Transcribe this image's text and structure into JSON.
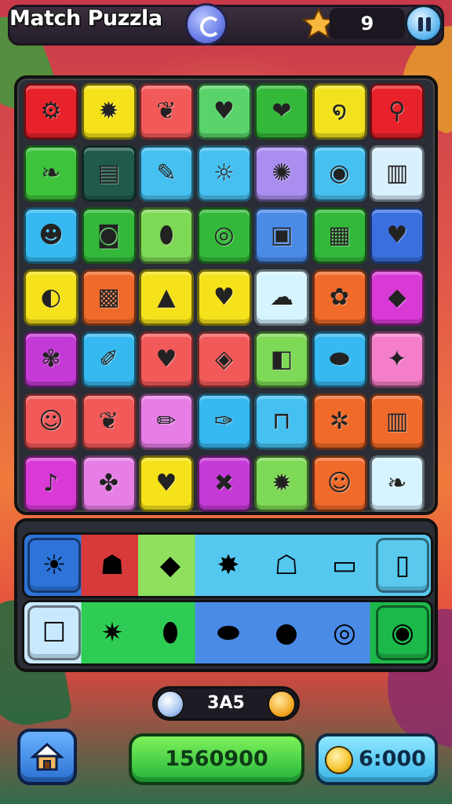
{
  "header": {
    "title": "Match Puzzla",
    "star_count": "9"
  },
  "board": {
    "rows": [
      [
        {
          "color": "#e8222a",
          "icon": "gear-icon",
          "glyph": "⚙"
        },
        {
          "color": "#f5e21a",
          "icon": "flower-icon",
          "glyph": "✹"
        },
        {
          "color": "#f25a5a",
          "icon": "leaf-icon",
          "glyph": "❦"
        },
        {
          "color": "#5ad46a",
          "icon": "heart-icon",
          "glyph": "♥"
        },
        {
          "color": "#34b83a",
          "icon": "strawberry-icon",
          "glyph": "❤"
        },
        {
          "color": "#f2e21e",
          "icon": "swirl-icon",
          "glyph": "໑"
        },
        {
          "color": "#e8222a",
          "icon": "magnifier-icon",
          "glyph": "⚲"
        }
      ],
      [
        {
          "color": "#3ec43c",
          "icon": "leaf-icon",
          "glyph": "❧"
        },
        {
          "color": "#1f5a4a",
          "icon": "document-icon",
          "glyph": "▤"
        },
        {
          "color": "#46c0f0",
          "icon": "pin-icon",
          "glyph": "✎"
        },
        {
          "color": "#46c0f0",
          "icon": "sun-face-icon",
          "glyph": "☼"
        },
        {
          "color": "#a98ef0",
          "icon": "sun-icon",
          "glyph": "✺"
        },
        {
          "color": "#46c0f0",
          "icon": "ring-icon",
          "glyph": "◉"
        },
        {
          "color": "#d9f0ff",
          "icon": "jar-icon",
          "glyph": "▥"
        }
      ],
      [
        {
          "color": "#36b9f0",
          "icon": "cat-face-icon",
          "glyph": "☻"
        },
        {
          "color": "#34b83a",
          "icon": "camera-icon",
          "glyph": "◙"
        },
        {
          "color": "#7ed956",
          "icon": "feather-icon",
          "glyph": "⬮"
        },
        {
          "color": "#34b83a",
          "icon": "donut-icon",
          "glyph": "◎"
        },
        {
          "color": "#4a8be8",
          "icon": "box-face-icon",
          "glyph": "▣"
        },
        {
          "color": "#34b83a",
          "icon": "picture-icon",
          "glyph": "▦"
        },
        {
          "color": "#3a6fe0",
          "icon": "heart-icon",
          "glyph": "♥"
        }
      ],
      [
        {
          "color": "#f5e21a",
          "icon": "ball-icon",
          "glyph": "◐"
        },
        {
          "color": "#f06a2a",
          "icon": "cookie-icon",
          "glyph": "▩"
        },
        {
          "color": "#f5e21a",
          "icon": "cone-icon",
          "glyph": "▲"
        },
        {
          "color": "#f5e21a",
          "icon": "heart-face-icon",
          "glyph": "♥"
        },
        {
          "color": "#d6f4ff",
          "icon": "blob-icon",
          "glyph": "☁"
        },
        {
          "color": "#f06a2a",
          "icon": "flower-icon",
          "glyph": "✿"
        },
        {
          "color": "#d93ad6",
          "icon": "crystal-icon",
          "glyph": "◆"
        }
      ],
      [
        {
          "color": "#c43ad6",
          "icon": "flower-icon",
          "glyph": "✾"
        },
        {
          "color": "#36b9f0",
          "icon": "pencil-icon",
          "glyph": "✐"
        },
        {
          "color": "#f25a5a",
          "icon": "heart-face-icon",
          "glyph": "♥"
        },
        {
          "color": "#f25a5a",
          "icon": "badge-icon",
          "glyph": "◈"
        },
        {
          "color": "#7ed956",
          "icon": "cube-icon",
          "glyph": "◧"
        },
        {
          "color": "#36b9f0",
          "icon": "eggplant-icon",
          "glyph": "⬬"
        },
        {
          "color": "#f47ec9",
          "icon": "chat-bubble-icon",
          "glyph": "✦"
        }
      ],
      [
        {
          "color": "#f25a5a",
          "icon": "smiley-icon",
          "glyph": "☺"
        },
        {
          "color": "#f25a5a",
          "icon": "leaf-icon",
          "glyph": "❦"
        },
        {
          "color": "#e77ee6",
          "icon": "pencil-icon",
          "glyph": "✏"
        },
        {
          "color": "#36b9f0",
          "icon": "brush-icon",
          "glyph": "✑"
        },
        {
          "color": "#46c0f0",
          "icon": "table-icon",
          "glyph": "⊓"
        },
        {
          "color": "#f06a2a",
          "icon": "gear-icon",
          "glyph": "✲"
        },
        {
          "color": "#f06a2a",
          "icon": "jar-icon",
          "glyph": "▥"
        }
      ],
      [
        {
          "color": "#d93ad6",
          "icon": "bell-icon",
          "glyph": "♪"
        },
        {
          "color": "#e77ee6",
          "icon": "star-blob-icon",
          "glyph": "✤"
        },
        {
          "color": "#f5e21a",
          "icon": "heart-icon",
          "glyph": "♥"
        },
        {
          "color": "#c43ad6",
          "icon": "cross-icon",
          "glyph": "✖"
        },
        {
          "color": "#7ed956",
          "icon": "sun-icon",
          "glyph": "✹"
        },
        {
          "color": "#f06a2a",
          "icon": "smiley-icon",
          "glyph": "☺"
        },
        {
          "color": "#d6f4ff",
          "icon": "leaf-icon",
          "glyph": "❧"
        }
      ]
    ]
  },
  "tray": {
    "row1": [
      {
        "icon": "sun-face-icon",
        "glyph": "☀"
      },
      {
        "icon": "ghost-icon",
        "glyph": "☗"
      },
      {
        "icon": "diamond-icon",
        "glyph": "◆"
      },
      {
        "icon": "spiky-ball-icon",
        "glyph": "✸"
      },
      {
        "icon": "robot-icon",
        "glyph": "☖"
      },
      {
        "icon": "card-icon",
        "glyph": "▭"
      },
      {
        "icon": "bin-icon",
        "glyph": "▯"
      }
    ],
    "row2": [
      {
        "icon": "jar-icon",
        "glyph": "☐"
      },
      {
        "icon": "bug-icon",
        "glyph": "✷"
      },
      {
        "icon": "popsicle-icon",
        "glyph": "⬮"
      },
      {
        "icon": "eggplant-icon",
        "glyph": "⬬"
      },
      {
        "icon": "apple-icon",
        "glyph": "●"
      },
      {
        "icon": "donut-icon",
        "glyph": "◎"
      },
      {
        "icon": "candy-icon",
        "glyph": "◉"
      }
    ]
  },
  "footer": {
    "moves_value": "3A5",
    "score": "1560900",
    "coins": "6:000"
  }
}
